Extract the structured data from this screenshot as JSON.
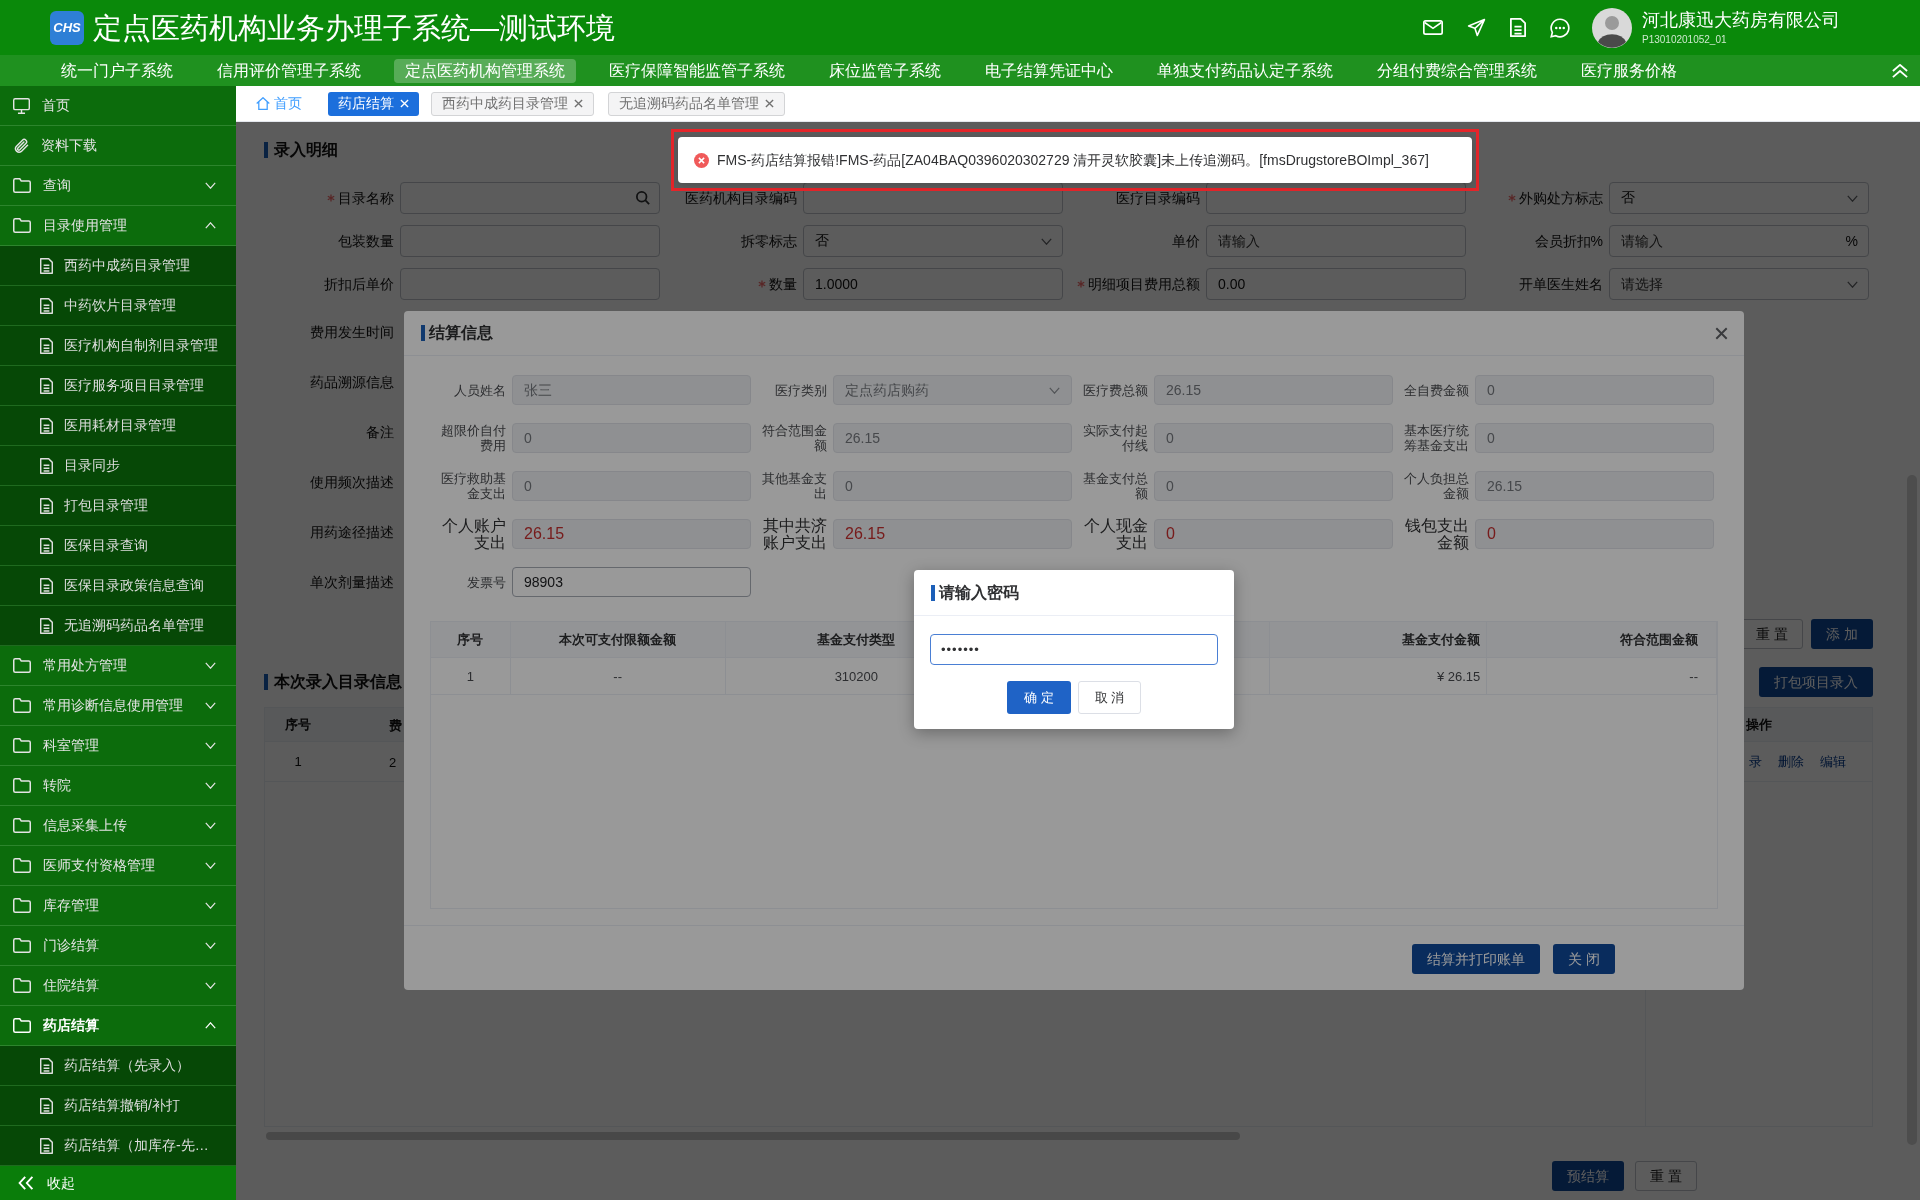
{
  "header": {
    "logo": "CHS",
    "title": "定点医药机构业务办理子系统—测试环境",
    "user": {
      "name": "河北康迅大药房有限公司",
      "code": "P13010201052_01"
    }
  },
  "top_nav": [
    {
      "label": "统一门户子系统",
      "selected": false
    },
    {
      "label": "信用评价管理子系统",
      "selected": false
    },
    {
      "label": "定点医药机构管理系统",
      "selected": true
    },
    {
      "label": "医疗保障智能监管子系统",
      "selected": false
    },
    {
      "label": "床位监管子系统",
      "selected": false
    },
    {
      "label": "电子结算凭证中心",
      "selected": false
    },
    {
      "label": "单独支付药品认定子系统",
      "selected": false
    },
    {
      "label": "分组付费综合管理系统",
      "selected": false
    },
    {
      "label": "医疗服务价格",
      "selected": false
    }
  ],
  "sidebar": {
    "items": [
      {
        "label": "首页",
        "kind": "home",
        "selected": false
      },
      {
        "label": "资料下载",
        "kind": "download",
        "selected": false
      },
      {
        "label": "查询",
        "kind": "group",
        "expanded": false,
        "selected": false
      },
      {
        "label": "目录使用管理",
        "kind": "group",
        "expanded": true,
        "selected": false,
        "children": [
          {
            "label": "西药中成药目录管理",
            "selected": false
          },
          {
            "label": "中药饮片目录管理",
            "selected": false
          },
          {
            "label": "医疗机构自制剂目录管理",
            "selected": false
          },
          {
            "label": "医疗服务项目目录管理",
            "selected": false
          },
          {
            "label": "医用耗材目录管理",
            "selected": false
          },
          {
            "label": "目录同步",
            "selected": false
          },
          {
            "label": "打包目录管理",
            "selected": false
          },
          {
            "label": "医保目录查询",
            "selected": false
          },
          {
            "label": "医保目录政策信息查询",
            "selected": false
          },
          {
            "label": "无追溯码药品名单管理",
            "selected": false
          }
        ]
      },
      {
        "label": "常用处方管理",
        "kind": "group",
        "expanded": false,
        "selected": false
      },
      {
        "label": "常用诊断信息使用管理",
        "kind": "group",
        "expanded": false,
        "selected": false
      },
      {
        "label": "科室管理",
        "kind": "group",
        "expanded": false,
        "selected": false
      },
      {
        "label": "转院",
        "kind": "group",
        "expanded": false,
        "selected": false
      },
      {
        "label": "信息采集上传",
        "kind": "group",
        "expanded": false,
        "selected": false
      },
      {
        "label": "医师支付资格管理",
        "kind": "group",
        "expanded": false,
        "selected": false
      },
      {
        "label": "库存管理",
        "kind": "group",
        "expanded": false,
        "selected": false
      },
      {
        "label": "门诊结算",
        "kind": "group",
        "expanded": false,
        "selected": false
      },
      {
        "label": "住院结算",
        "kind": "group",
        "expanded": false,
        "selected": false
      },
      {
        "label": "药店结算",
        "kind": "group",
        "expanded": true,
        "selected": true,
        "children": [
          {
            "label": "药店结算（先录入）",
            "selected": false
          },
          {
            "label": "药店结算撤销/补打",
            "selected": false
          },
          {
            "label": "药店结算（加库存-先…",
            "selected": false
          }
        ]
      }
    ],
    "collapse": "收起"
  },
  "tabs": [
    {
      "label": "首页",
      "kind": "home",
      "selected": false,
      "closable": false
    },
    {
      "label": "药店结算",
      "kind": "page",
      "selected": true,
      "closable": true
    },
    {
      "label": "西药中成药目录管理",
      "kind": "page",
      "selected": false,
      "closable": true
    },
    {
      "label": "无追溯码药品名单管理",
      "kind": "page",
      "selected": false,
      "closable": true
    }
  ],
  "toast": {
    "kind": "error",
    "message": "FMS-药店结算报错!FMS-药品[ZA04BAQ0396020302729 清开灵软胶囊]未上传追溯码。[fmsDrugstoreBOImpl_367]",
    "outlined": true
  },
  "detail_entry": {
    "title": "录入明细",
    "fields": [
      {
        "label": "目录名称",
        "kind": "search",
        "required": true
      },
      {
        "label": "医药机构目录编码",
        "kind": "text",
        "required": false
      },
      {
        "label": "医疗目录编码",
        "kind": "text",
        "required": false
      },
      {
        "label": "外购处方标志",
        "kind": "select",
        "value": "否",
        "required": true
      },
      {
        "label": "包装数量",
        "kind": "text",
        "required": false
      },
      {
        "label": "拆零标志",
        "kind": "select",
        "value": "否",
        "required": false
      },
      {
        "label": "单价",
        "kind": "text",
        "placeholder": "请输入",
        "required": false
      },
      {
        "label": "会员折扣%",
        "kind": "text",
        "placeholder": "请输入",
        "suffix": "%",
        "required": false
      },
      {
        "label": "折扣后单价",
        "kind": "text",
        "required": false
      },
      {
        "label": "数量",
        "kind": "text",
        "value": "1.0000",
        "required": true
      },
      {
        "label": "明细项目费用总额",
        "kind": "text",
        "value": "0.00",
        "required": true
      },
      {
        "label": "开单医生姓名",
        "kind": "select",
        "placeholder": "请选择",
        "required": false
      }
    ],
    "more_labels": [
      "费用发生时间",
      "药品溯源信息",
      "备注",
      "使用频次描述",
      "用药途径描述",
      "单次剂量描述"
    ],
    "buttons": [
      {
        "label": "重 置",
        "kind": "default"
      },
      {
        "label": "添 加",
        "kind": "primary"
      }
    ]
  },
  "entered_items": {
    "title": "本次录入目录信息",
    "pack_button": "打包项目录入",
    "columns": [
      "序号",
      "费"
    ],
    "action_column": "操作",
    "rows": [
      {
        "cells": [
          "1",
          "2"
        ],
        "actions": [
          "录",
          "删除",
          "编辑"
        ]
      }
    ]
  },
  "footer_buttons": [
    {
      "label": "预结算",
      "kind": "primary"
    },
    {
      "label": "重 置",
      "kind": "default"
    }
  ],
  "settlement_dialog": {
    "title": "结算信息",
    "fields": [
      {
        "label": "人员姓名",
        "value": "张三",
        "kind": "text",
        "disabled": true
      },
      {
        "label": "医疗类别",
        "value": "定点药店购药",
        "kind": "select",
        "disabled": true
      },
      {
        "label": "医疗费总额",
        "value": "26.15",
        "kind": "text",
        "disabled": true
      },
      {
        "label": "全自费金额",
        "value": "0",
        "kind": "text",
        "disabled": true
      },
      {
        "label": "超限价自付费用",
        "value": "0",
        "kind": "text",
        "disabled": true
      },
      {
        "label": "符合范围金额",
        "value": "26.15",
        "kind": "text",
        "disabled": true
      },
      {
        "label": "实际支付起付线",
        "value": "0",
        "kind": "text",
        "disabled": true
      },
      {
        "label": "基本医疗统筹基金支出",
        "value": "0",
        "kind": "text",
        "disabled": true
      },
      {
        "label": "医疗救助基金支出",
        "value": "0",
        "kind": "text",
        "disabled": true
      },
      {
        "label": "其他基金支出",
        "value": "0",
        "kind": "text",
        "disabled": true
      },
      {
        "label": "基金支付总额",
        "value": "0",
        "kind": "text",
        "disabled": true
      },
      {
        "label": "个人负担总金额",
        "value": "26.15",
        "kind": "text",
        "disabled": true
      },
      {
        "label": "个人账户支出",
        "value": "26.15",
        "kind": "amount",
        "disabled": true
      },
      {
        "label": "其中共济账户支出",
        "value": "26.15",
        "kind": "amount",
        "disabled": true
      },
      {
        "label": "个人现金支出",
        "value": "0",
        "kind": "amount",
        "disabled": true
      },
      {
        "label": "钱包支出金额",
        "value": "0",
        "kind": "amount",
        "disabled": true
      },
      {
        "label": "发票号",
        "value": "98903",
        "kind": "text",
        "disabled": false
      }
    ],
    "table": {
      "columns": [
        "序号",
        "本次可支付限额金额",
        "基金支付类型",
        "基金支付金额",
        "符合范围金额"
      ],
      "rows": [
        [
          "1",
          "--",
          "310200",
          "¥ 26.15",
          "--"
        ]
      ]
    },
    "buttons": [
      {
        "label": "结算并打印账单",
        "kind": "primary"
      },
      {
        "label": "关 闭",
        "kind": "primary"
      }
    ]
  },
  "password_dialog": {
    "title": "请输入密码",
    "value": "•••••••",
    "buttons": [
      {
        "label": "确 定",
        "kind": "primary"
      },
      {
        "label": "取 消",
        "kind": "default"
      }
    ]
  }
}
